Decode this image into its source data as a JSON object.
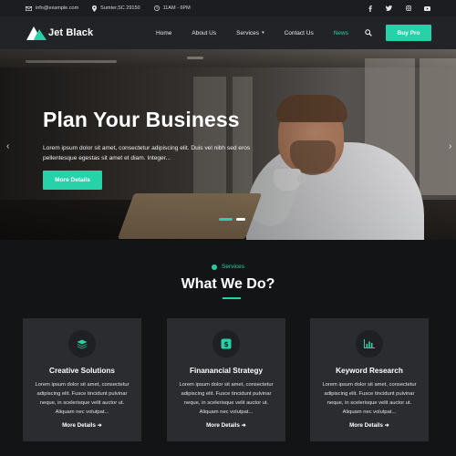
{
  "topbar": {
    "email": "info@example.com",
    "location": "Sumter,SC 29150",
    "hours": "11AM - 6PM",
    "social_icons": [
      "facebook-icon",
      "twitter-icon",
      "instagram-icon",
      "youtube-icon"
    ]
  },
  "header": {
    "logo_text": "Jet Black",
    "nav": [
      {
        "label": "Home"
      },
      {
        "label": "About Us"
      },
      {
        "label": "Services",
        "has_dropdown": true
      },
      {
        "label": "Contact Us"
      },
      {
        "label": "News",
        "active": true
      }
    ],
    "cta_label": "Buy Pro"
  },
  "hero": {
    "title": "Plan Your Business",
    "text": "Lorem ipsum dolor sit amet, consectetur adipiscing elit. Duis vel nibh sed eros pellentesque egestas sit amet et diam. Integer...",
    "button_label": "More Details",
    "prev_glyph": "‹",
    "next_glyph": "›"
  },
  "services": {
    "eyebrow": "Services",
    "title": "What We Do?",
    "cards": [
      {
        "icon": "layers-icon",
        "title": "Creative Solutions",
        "text": "Lorem ipsum dolor sit amet, consectetur adipiscing elit. Fusce tincidunt pulvinar neque, in scelerisque velit auctor ut. Aliquam nec volutpat...",
        "link": "More Details"
      },
      {
        "icon": "dollar-icon",
        "title": "Finanancial Strategy",
        "text": "Lorem ipsum dolor sit amet, consectetur adipiscing elit. Fusce tincidunt pulvinar neque, in scelerisque velit auctor ut. Aliquam nec volutpat...",
        "link": "More Details"
      },
      {
        "icon": "bar-chart-icon",
        "title": "Keyword Research",
        "text": "Lorem ipsum dolor sit amet, consectetur adipiscing elit. Fusce tincidunt pulvinar neque, in scelerisque velit auctor ut. Aliquam nec volutpat...",
        "link": "More Details"
      }
    ]
  },
  "colors": {
    "accent": "#27d2a8",
    "background": "#131416",
    "card": "#2b2c30"
  }
}
